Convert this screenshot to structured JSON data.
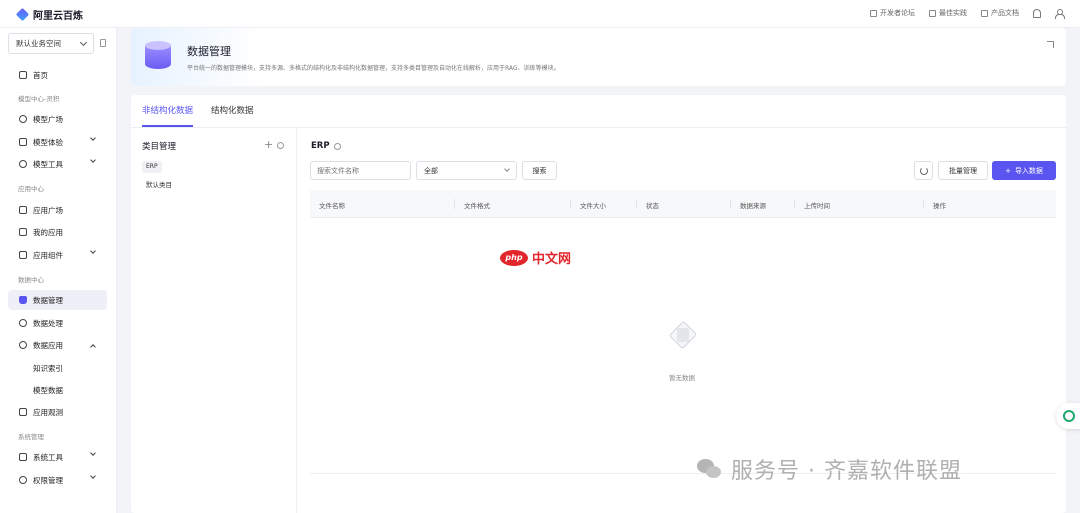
{
  "brand": {
    "name": "阿里云百炼"
  },
  "top_links": [
    {
      "label": "开发者论坛",
      "icon": "forum-icon"
    },
    {
      "label": "最佳实践",
      "icon": "practice-icon"
    },
    {
      "label": "产品文档",
      "icon": "doc-icon"
    }
  ],
  "workspace": {
    "label": "默认业务空间"
  },
  "sidebar": {
    "home": "首页",
    "sec_model": "模型中心-灵积",
    "model_square": "模型广场",
    "model_try": "模型体验",
    "model_tools": "模型工具",
    "sec_app": "应用中心",
    "app_square": "应用广场",
    "my_apps": "我的应用",
    "app_components": "应用组件",
    "sec_data": "数据中心",
    "data_manage": "数据管理",
    "data_process": "数据处理",
    "data_app": "数据应用",
    "knowledge_index": "知识索引",
    "model_data": "模型数据",
    "app_observe": "应用观测",
    "sec_sys": "系统管理",
    "sys_tools": "系统工具",
    "perm_manage": "权限管理"
  },
  "header": {
    "title": "数据管理",
    "desc": "平台统一的数据管理模块，支持多源、多格式的结构化及非结构化数据管理，支持多类目管理及自动化在线解析，应用于RAG、训练等模块。"
  },
  "tabs": [
    {
      "label": "非结构化数据",
      "active": true
    },
    {
      "label": "结构化数据",
      "active": false
    }
  ],
  "category": {
    "title": "类目管理",
    "plus": "+",
    "items": [
      "ERP",
      "默认类目"
    ]
  },
  "content": {
    "title": "ERP",
    "search_placeholder": "搜索文件名称",
    "filter_value": "全部",
    "search_btn": "搜索",
    "batch_btn": "批量管理",
    "import_btn": "导入数据",
    "import_plus": "+",
    "columns": [
      "文件名称",
      "文件格式",
      "文件大小",
      "状态",
      "数据来源",
      "上传时间",
      "操作"
    ],
    "empty_text": "暂无数据"
  },
  "watermarks": {
    "php_badge": "php",
    "php_text": "中文网",
    "bottom": "服务号 · 齐嘉软件联盟"
  },
  "colors": {
    "accent": "#5a55f0",
    "ai_icon": "#20a870"
  }
}
